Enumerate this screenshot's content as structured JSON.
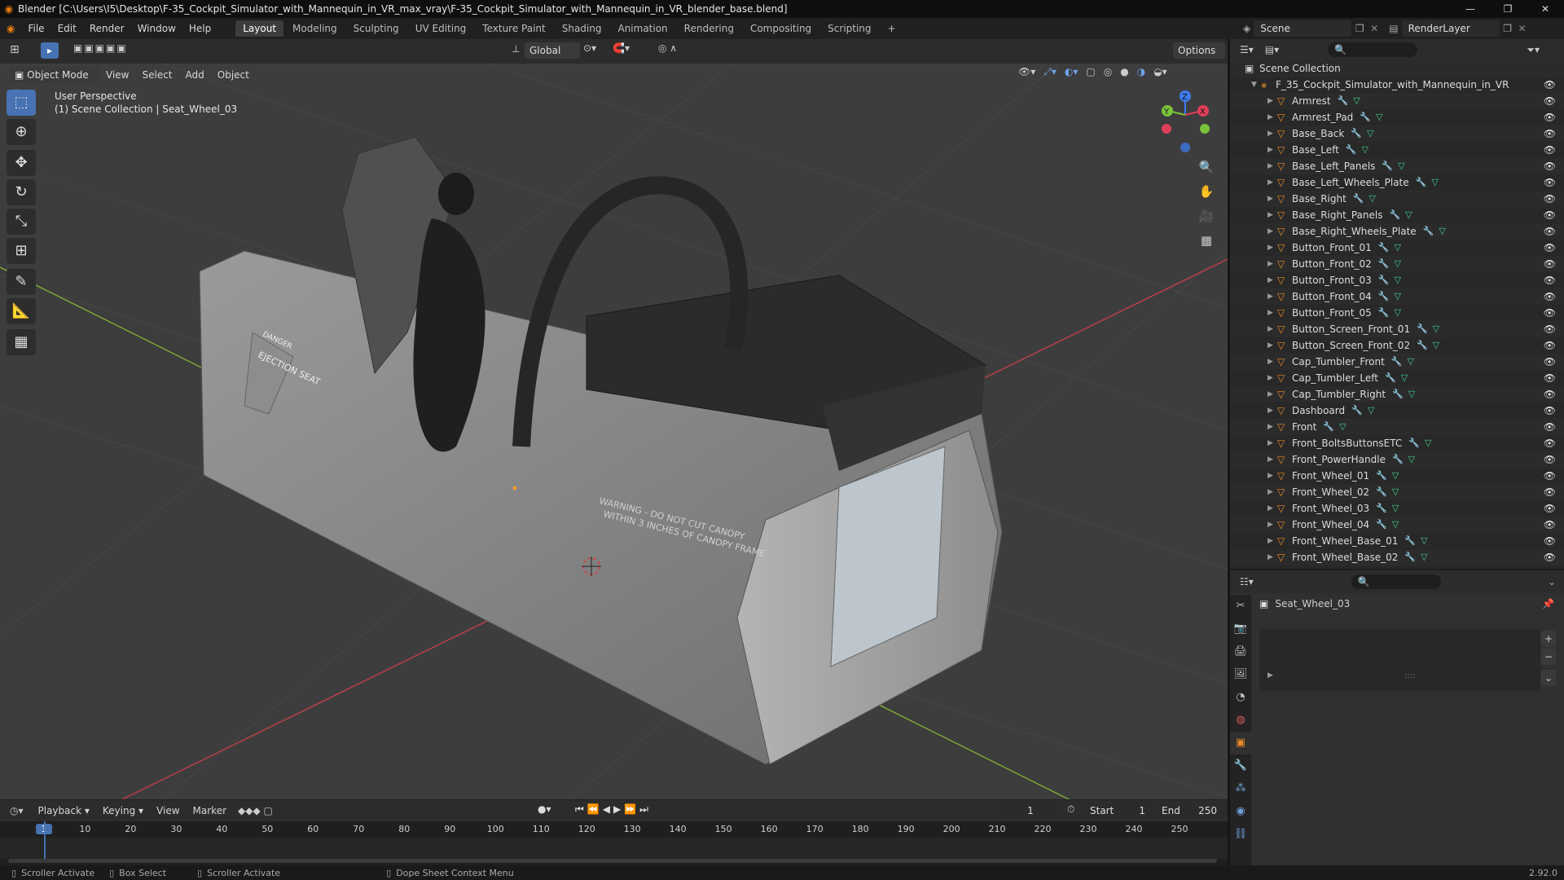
{
  "titlebar": {
    "title": "Blender [C:\\Users\\I5\\Desktop\\F-35_Cockpit_Simulator_with_Mannequin_in_VR_max_vray\\F-35_Cockpit_Simulator_with_Mannequin_in_VR_blender_base.blend]",
    "min": "—",
    "max": "❐",
    "close": "✕"
  },
  "menu": [
    "File",
    "Edit",
    "Render",
    "Window",
    "Help"
  ],
  "workspaces": [
    "Layout",
    "Modeling",
    "Sculpting",
    "UV Editing",
    "Texture Paint",
    "Shading",
    "Animation",
    "Rendering",
    "Compositing",
    "Scripting",
    "+"
  ],
  "scene": {
    "label": "Scene",
    "renderlayer": "RenderLayer"
  },
  "toolheader": {
    "transform": "Global",
    "options": "Options"
  },
  "viewport": {
    "mode": "Object Mode",
    "menus": [
      "View",
      "Select",
      "Add",
      "Object"
    ],
    "perspective": "User Perspective",
    "collection_info": "(1) Scene Collection | Seat_Wheel_03",
    "model_text": {
      "ejection": "EJECTION SEAT",
      "danger": "DANGER",
      "warning1": "WARNING - DO NOT CUT CANOPY",
      "warning2": "WITHIN 3 INCHES OF CANOPY FRAME"
    },
    "gizmo": {
      "x": "X",
      "y": "Y",
      "z": "Z"
    },
    "colors": {
      "bg": "#3d3d3d",
      "grid": "#4a4a4a",
      "x_axis": "#b8404a",
      "y_axis": "#7aa63a"
    }
  },
  "tools": [
    "select-box",
    "cursor",
    "move",
    "rotate",
    "scale",
    "transform",
    "annotate",
    "measure",
    "add-cube"
  ],
  "outliner": {
    "root": "Scene Collection",
    "collection": "F_35_Cockpit_Simulator_with_Mannequin_in_VR",
    "items": [
      "Armrest",
      "Armrest_Pad",
      "Base_Back",
      "Base_Left",
      "Base_Left_Panels",
      "Base_Left_Wheels_Plate",
      "Base_Right",
      "Base_Right_Panels",
      "Base_Right_Wheels_Plate",
      "Button_Front_01",
      "Button_Front_02",
      "Button_Front_03",
      "Button_Front_04",
      "Button_Front_05",
      "Button_Screen_Front_01",
      "Button_Screen_Front_02",
      "Cap_Tumbler_Front",
      "Cap_Tumbler_Left",
      "Cap_Tumbler_Right",
      "Dashboard",
      "Front",
      "Front_BoltsButtonsETC",
      "Front_PowerHandle",
      "Front_Wheel_01",
      "Front_Wheel_02",
      "Front_Wheel_03",
      "Front_Wheel_04",
      "Front_Wheel_Base_01",
      "Front_Wheel_Base_02"
    ]
  },
  "properties": {
    "object": "Seat_Wheel_03"
  },
  "timeline": {
    "menus": [
      "Playback",
      "Keying",
      "View",
      "Marker"
    ],
    "current_frame": "1",
    "start_label": "Start",
    "start": "1",
    "end_label": "End",
    "end": "250",
    "ticks": [
      "1",
      "10",
      "20",
      "30",
      "40",
      "50",
      "60",
      "70",
      "80",
      "90",
      "100",
      "110",
      "120",
      "130",
      "140",
      "150",
      "160",
      "170",
      "180",
      "190",
      "200",
      "210",
      "220",
      "230",
      "240",
      "250"
    ]
  },
  "status": {
    "s1": "Scroller Activate",
    "s2": "Box Select",
    "s3": "Scroller Activate",
    "s4": "Dope Sheet Context Menu",
    "version": "2.92.0"
  }
}
